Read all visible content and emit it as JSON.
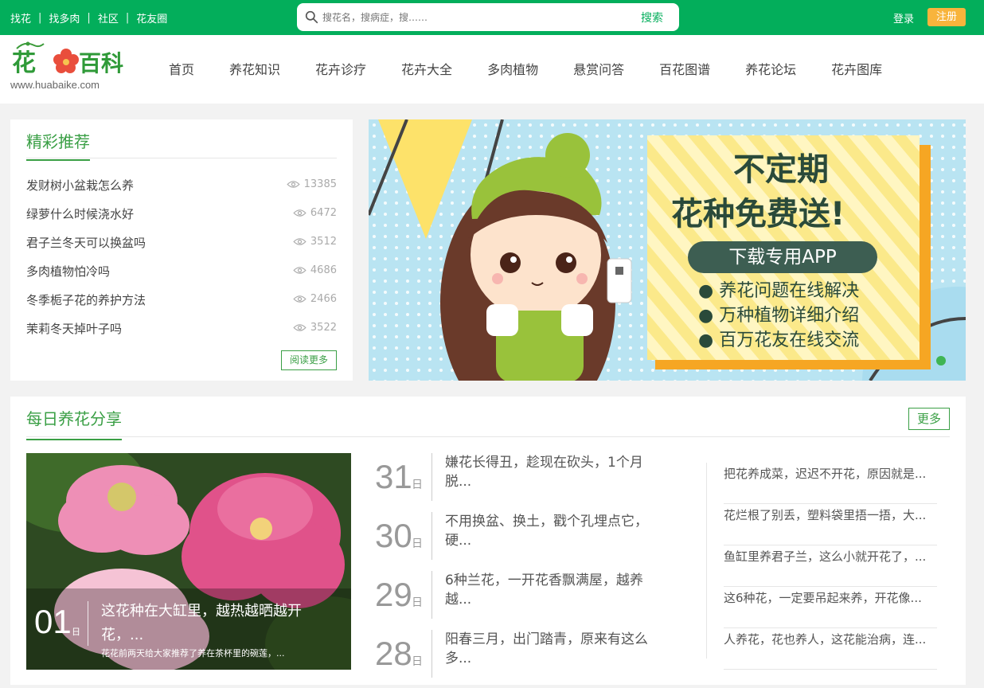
{
  "topbar": {
    "links": [
      "找花",
      "找多肉",
      "社区",
      "花友圈"
    ],
    "separator": "|",
    "search_placeholder": "搜花名，搜病症，搜……",
    "search_button": "搜索",
    "login": "登录",
    "register": "注册"
  },
  "logo": {
    "text_cn": "花百科",
    "url": "www.huabaike.com"
  },
  "nav": [
    "首页",
    "养花知识",
    "花卉诊疗",
    "花卉大全",
    "多肉植物",
    "悬赏问答",
    "百花图谱",
    "养花论坛",
    "花卉图库"
  ],
  "featured": {
    "title": "精彩推荐",
    "items": [
      {
        "q": "发财树小盆栽怎么养",
        "views": "13385"
      },
      {
        "q": "绿萝什么时候浇水好",
        "views": "6472"
      },
      {
        "q": "君子兰冬天可以换盆吗",
        "views": "3512"
      },
      {
        "q": "多肉植物怕冷吗",
        "views": "4686"
      },
      {
        "q": "冬季栀子花的养护方法",
        "views": "2466"
      },
      {
        "q": "茉莉冬天掉叶子吗",
        "views": "3522"
      }
    ],
    "read_more": "阅读更多"
  },
  "banner": {
    "line1": "不定期",
    "line2": "花种免费送!",
    "pill": "下载专用APP",
    "bullets": [
      "养花问题在线解决",
      "万种植物详细介绍",
      "百万花友在线交流"
    ]
  },
  "daily": {
    "title": "每日养花分享",
    "more": "更多",
    "day_suffix": "日",
    "photo": {
      "day": "01",
      "title": "这花种在大缸里，越热越晒越开花，...",
      "subtitle": "花花前两天给大家推荐了养在茶杯里的碗莲，..."
    },
    "dates": [
      {
        "day": "31",
        "text": "嫌花长得丑，趁现在砍头，1个月脱..."
      },
      {
        "day": "30",
        "text": "不用换盆、换土，戳个孔埋点它，硬..."
      },
      {
        "day": "29",
        "text": "6种兰花，一开花香飘满屋，越养越..."
      },
      {
        "day": "28",
        "text": "阳春三月，出门踏青，原来有这么多..."
      }
    ],
    "right_list": [
      "把花养成菜，迟迟不开花，原因就是...",
      "花烂根了别丢，塑料袋里捂一捂，大...",
      "鱼缸里养君子兰，这么小就开花了，...",
      "这6种花，一定要吊起来养，开花像...",
      "人养花，花也养人，这花能治病，连..."
    ]
  },
  "colors": {
    "brand_green": "#03ae5b",
    "title_green": "#3a9f45",
    "register_orange": "#f8b43c"
  }
}
